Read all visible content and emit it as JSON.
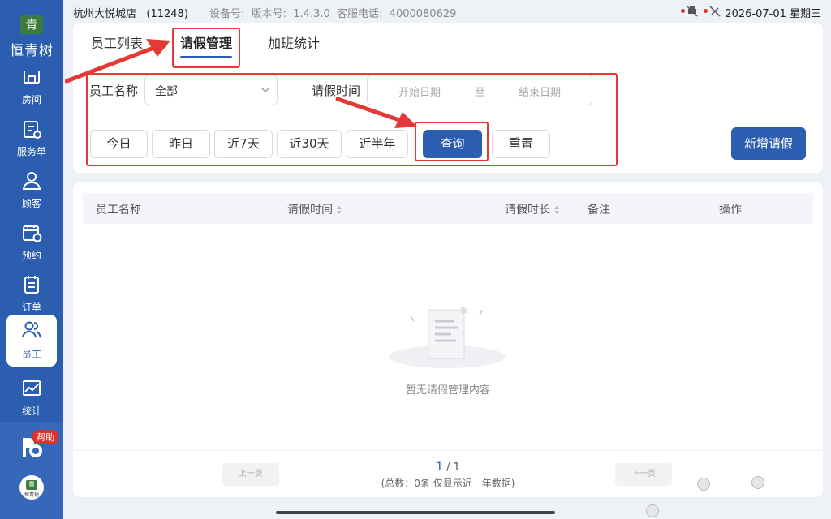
{
  "sidebar": {
    "brand_logo_char": "青",
    "brand_name": "恒青树",
    "items": [
      {
        "label": "房间",
        "icon": "room-icon"
      },
      {
        "label": "服务单",
        "icon": "service-order-icon"
      },
      {
        "label": "顾客",
        "icon": "customer-icon"
      },
      {
        "label": "预约",
        "icon": "calendar-icon"
      },
      {
        "label": "订单",
        "icon": "order-icon"
      },
      {
        "label": "员工",
        "icon": "staff-icon",
        "active": true
      },
      {
        "label": "统计",
        "icon": "chart-icon"
      }
    ],
    "help_badge": "帮助",
    "avatar_char": "青",
    "avatar_text": "恒青树"
  },
  "statusbar": {
    "store": "杭州大悦城店   (11248)",
    "meta": "设备号:  版本号:  1.4.3.0  客服电话:  4000080629",
    "datetime": "2026-07-01 星期三"
  },
  "tabs": [
    {
      "label": "员工列表"
    },
    {
      "label": "请假管理",
      "active": true
    },
    {
      "label": "加班统计"
    }
  ],
  "filters": {
    "employee_label": "员工名称",
    "employee_value": "全部",
    "leave_time_label": "请假时间",
    "start_placeholder": "开始日期",
    "range_sep": "至",
    "end_placeholder": "结束日期",
    "quick": [
      "今日",
      "昨日",
      "近7天",
      "近30天",
      "近半年"
    ],
    "query": "查询",
    "reset": "重置",
    "add": "新增请假"
  },
  "table": {
    "columns": [
      "员工名称",
      "请假时间",
      "请假时长",
      "备注",
      "操作"
    ],
    "empty_text": "暂无请假管理内容"
  },
  "pagination": {
    "prev": "上一页",
    "next": "下一页",
    "current": "1",
    "total_pages": "1",
    "summary": "(总数：0条 仅显示近一年数据)"
  },
  "colors": {
    "primary": "#2b5db0",
    "annotation": "#e53935"
  }
}
